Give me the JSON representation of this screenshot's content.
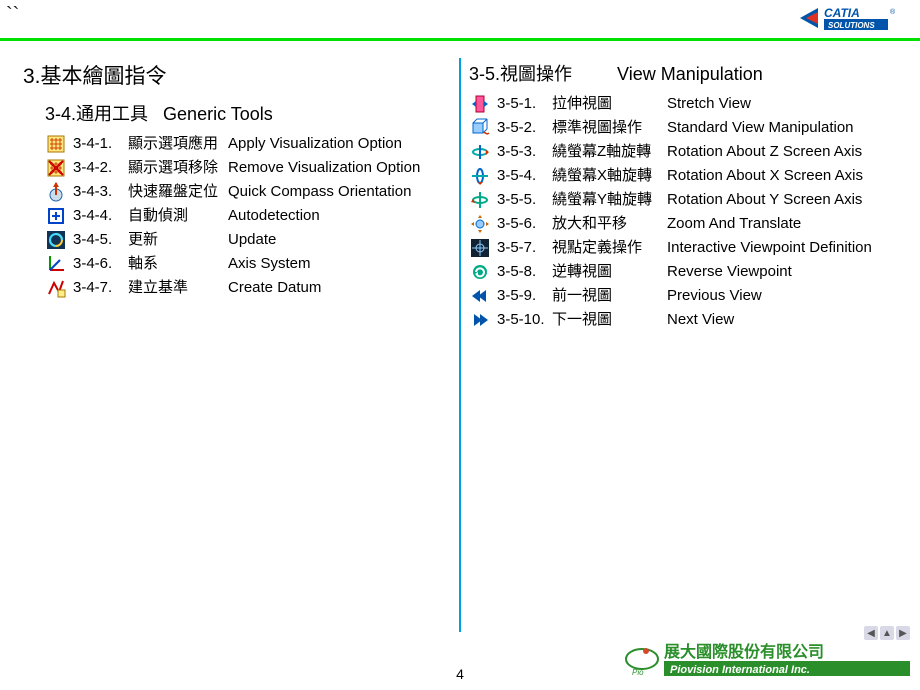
{
  "page_number": "4",
  "brand_tr": "CATIA SOLUTIONS",
  "brand_br_zh": "展大國際股份有限公司",
  "brand_br_en": "Piovision International Inc.",
  "left": {
    "heading": "3.基本繪圖指令",
    "subheading_zh": "3-4.通用工具",
    "subheading_en": "Generic Tools",
    "items": [
      {
        "num": "3-4-1.",
        "zh": "顯示選項應用",
        "en": "Apply Visualization Option",
        "icon": "grid-apply"
      },
      {
        "num": "3-4-2.",
        "zh": "顯示選項移除",
        "en": "Remove Visualization Option",
        "icon": "grid-remove"
      },
      {
        "num": "3-4-3.",
        "zh": "快速羅盤定位",
        "en": "Quick Compass Orientation",
        "icon": "compass"
      },
      {
        "num": "3-4-4.",
        "zh": "自動偵測",
        "en": "Autodetection",
        "icon": "plus-box"
      },
      {
        "num": "3-4-5.",
        "zh": "更新",
        "en": "Update",
        "icon": "swirl"
      },
      {
        "num": "3-4-6.",
        "zh": "軸系",
        "en": "Axis System",
        "icon": "axis"
      },
      {
        "num": "3-4-7.",
        "zh": "建立基準",
        "en": "Create Datum",
        "icon": "datum"
      }
    ]
  },
  "right": {
    "subheading_zh": "3-5.視圖操作",
    "subheading_en": "View Manipulation",
    "items": [
      {
        "num": "3-5-1.",
        "zh": "拉伸視圖",
        "en": "Stretch View",
        "icon": "stretch"
      },
      {
        "num": "3-5-2.",
        "zh": "標準視圖操作",
        "en": "Standard View Manipulation",
        "icon": "std-view"
      },
      {
        "num": "3-5-3.",
        "zh": "繞螢幕Z軸旋轉",
        "en": "Rotation About Z Screen Axis",
        "icon": "rot-z"
      },
      {
        "num": "3-5-4.",
        "zh": "繞螢幕X軸旋轉",
        "en": "Rotation About X Screen Axis",
        "icon": "rot-x"
      },
      {
        "num": "3-5-5.",
        "zh": "繞螢幕Y軸旋轉",
        "en": "Rotation About Y Screen Axis",
        "icon": "rot-y"
      },
      {
        "num": "3-5-6.",
        "zh": "放大和平移",
        "en": "Zoom And Translate",
        "icon": "zoom-pan"
      },
      {
        "num": "3-5-7.",
        "zh": "視點定義操作",
        "en": "Interactive Viewpoint Definition",
        "icon": "viewpoint"
      },
      {
        "num": "3-5-8.",
        "zh": "逆轉視圖",
        "en": "Reverse Viewpoint",
        "icon": "reverse"
      },
      {
        "num": "3-5-9.",
        "zh": "前一視圖",
        "en": "Previous View",
        "icon": "prev"
      },
      {
        "num": "3-5-10.",
        "zh": "下一視圖",
        "en": "Next View",
        "icon": "next"
      }
    ]
  }
}
